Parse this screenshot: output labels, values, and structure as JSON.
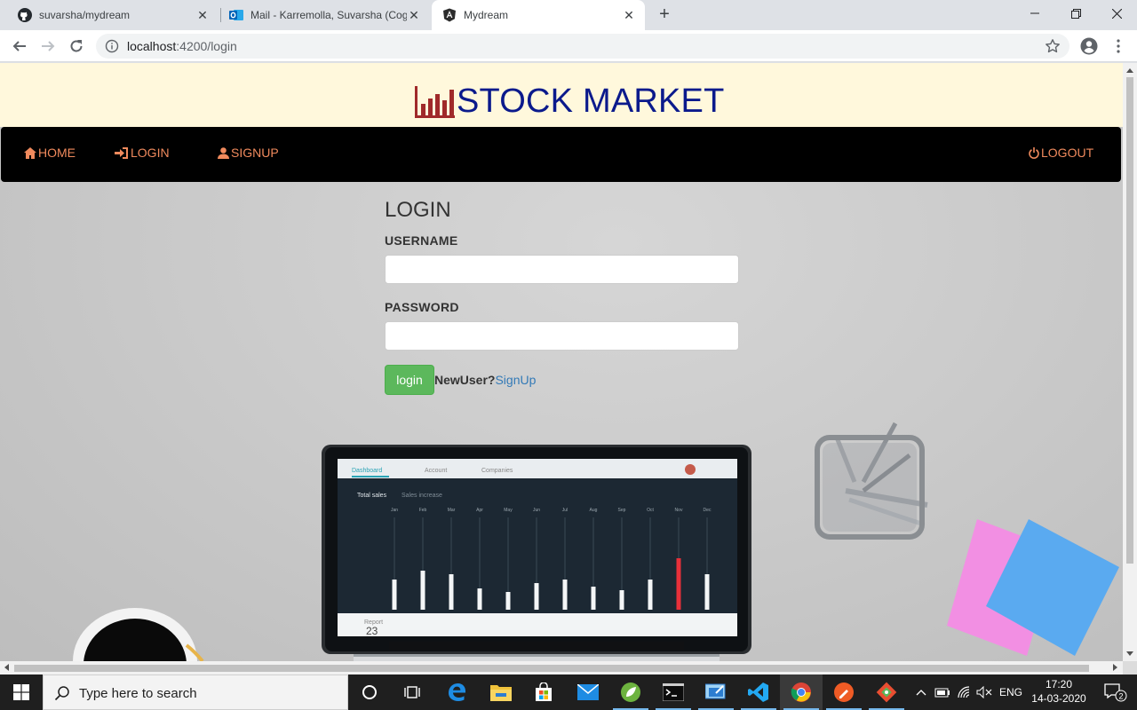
{
  "browser": {
    "tabs": [
      {
        "title": "suvarsha/mydream",
        "icon": "github-icon"
      },
      {
        "title": "Mail - Karremolla, Suvarsha (Cog",
        "icon": "outlook-icon"
      },
      {
        "title": "Mydream",
        "icon": "angular-icon"
      }
    ],
    "address": {
      "host": "localhost",
      "path": ":4200/login"
    }
  },
  "page": {
    "brand": "STOCK MARKET",
    "nav": {
      "home": "HOME",
      "login": "LOGIN",
      "signup": "SIGNUP",
      "logout": "LOGOUT"
    },
    "login": {
      "title": "LOGIN",
      "username_label": "USERNAME",
      "username_value": "",
      "password_label": "PASSWORD",
      "password_value": "",
      "button": "login",
      "newuser_text": "NewUser?",
      "signup_link": "SignUp"
    },
    "laptop_screen": {
      "tabs": [
        "Dashboard",
        "Account",
        "Companies"
      ],
      "heading": "Total sales",
      "subheading": "Sales increase",
      "months": [
        "Jan",
        "Feb",
        "Mar",
        "Apr",
        "May",
        "Jun",
        "Jul",
        "Aug",
        "Sep",
        "Oct",
        "Nov",
        "Dec"
      ],
      "report_label": "Report",
      "report_value": "23"
    }
  },
  "taskbar": {
    "search_placeholder": "Type here to search",
    "language": "ENG",
    "time": "17:20",
    "date": "14-03-2020",
    "notifications": "2"
  },
  "colors": {
    "nav_text": "#f08a5d",
    "brand_text": "#0b1a8c",
    "banner_bg": "#fff8dc",
    "login_button": "#5cb85c",
    "link": "#337ab7"
  }
}
